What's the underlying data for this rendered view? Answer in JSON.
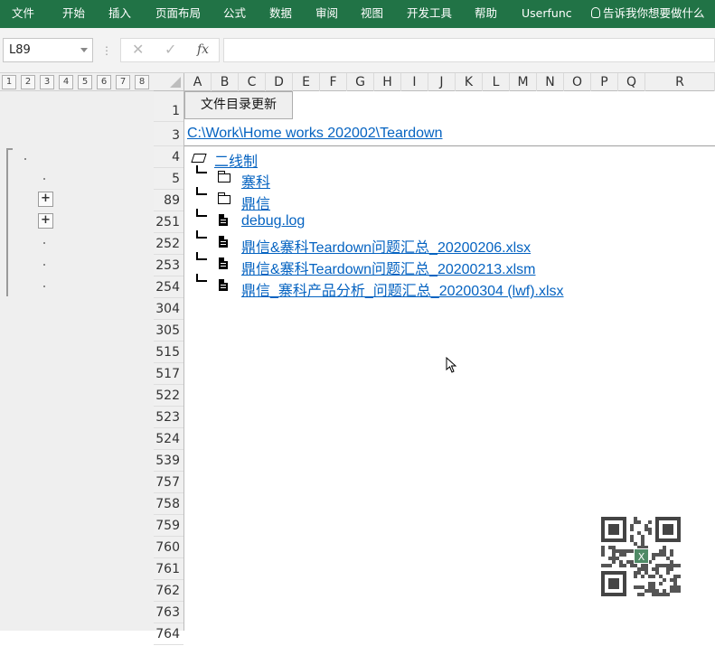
{
  "ribbon": {
    "tabs": [
      "文件",
      "开始",
      "插入",
      "页面布局",
      "公式",
      "数据",
      "审阅",
      "视图",
      "开发工具",
      "帮助",
      "Userfunc"
    ],
    "tell_me": "告诉我你想要做什么"
  },
  "formula_bar": {
    "name_box": "L89",
    "cancel": "✕",
    "confirm": "✓",
    "fx": "fx",
    "formula": ""
  },
  "outline_levels": [
    "1",
    "2",
    "3",
    "4",
    "5",
    "6",
    "7",
    "8"
  ],
  "columns": [
    "A",
    "B",
    "C",
    "D",
    "E",
    "F",
    "G",
    "H",
    "I",
    "J",
    "K",
    "L",
    "M",
    "N",
    "O",
    "P",
    "Q",
    "R"
  ],
  "rows": [
    "1",
    "3",
    "4",
    "5",
    "89",
    "251",
    "252",
    "253",
    "254",
    "304",
    "305",
    "515",
    "517",
    "522",
    "523",
    "524",
    "539",
    "757",
    "758",
    "759",
    "760",
    "761",
    "762",
    "763",
    "764"
  ],
  "sheet": {
    "update_button": "文件目录更新",
    "root_path": "C:\\Work\\Home works 202002\\Teardown",
    "tree": [
      {
        "icon": "folder-open",
        "text": "二线制"
      },
      {
        "icon": "folder",
        "text": "寨科"
      },
      {
        "icon": "folder",
        "text": "鼎信"
      },
      {
        "icon": "file",
        "text": "debug.log"
      },
      {
        "icon": "file",
        "text": "鼎信&寨科Teardown问题汇总_20200206.xlsx"
      },
      {
        "icon": "file",
        "text": "鼎信&寨科Teardown问题汇总_20200213.xlsm"
      },
      {
        "icon": "file",
        "text": "鼎信_寨科产品分析_问题汇总_20200304 (lwf).xlsx"
      }
    ]
  },
  "qr_badge": "X"
}
